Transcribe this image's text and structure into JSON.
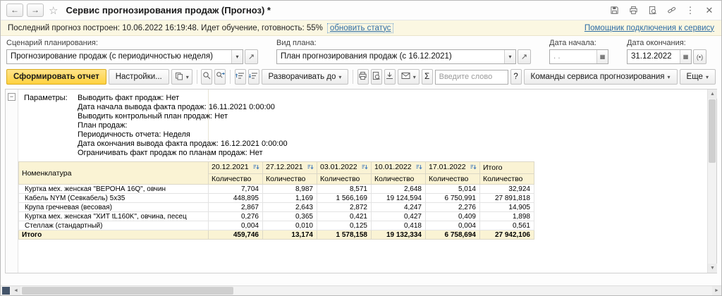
{
  "icons": {
    "back": "←",
    "forward": "→",
    "star": "☆",
    "more": "⋮",
    "close": "✕",
    "dropdown": "▾",
    "open": "↗",
    "calendar": "▦",
    "period": "(•)",
    "minus": "−",
    "scroll_up": "▲",
    "scroll_down": "▼",
    "scroll_left": "◄",
    "scroll_right": "►"
  },
  "window": {
    "title": "Сервис прогнозирования продаж (Прогноз) *"
  },
  "status": {
    "text": "Последний прогноз построен: 10.06.2022 16:19:48. Идет обучение, готовность: 55%",
    "refresh_link": "обновить статус",
    "helper_link": "Помощник подключения к сервису"
  },
  "form": {
    "scenario": {
      "label": "Сценарий планирования:",
      "value": "Прогнозирование продаж (с периодичностью неделя)"
    },
    "plan_kind": {
      "label": "Вид плана:",
      "value": "План прогнозирования продаж (с 16.12.2021)"
    },
    "date_start": {
      "label": "Дата начала:",
      "empty_mask": ". ."
    },
    "date_end": {
      "label": "Дата окончания:",
      "value": "31.12.2022"
    }
  },
  "toolbar": {
    "generate_label": "Сформировать отчет",
    "settings_label": "Настройки...",
    "expand_label": "Разворачивать до",
    "sigma_label": "Σ",
    "search_placeholder": "Введите слово",
    "help_label": "?",
    "commands_label": "Команды сервиса прогнозирования",
    "more_label": "Еще"
  },
  "report": {
    "params_label": "Параметры:",
    "params": [
      "Выводить факт продаж: Нет",
      "Дата начала вывода факта продаж: 16.11.2021 0:00:00",
      "Выводить контрольный план продаж: Нет",
      "План продаж:",
      "Периодичность отчета: Неделя",
      "Дата окончания вывода факта продаж: 16.12.2021 0:00:00",
      "Ограничивать факт продаж по планам продаж: Нет"
    ],
    "table": {
      "name_header": "Номенклатура",
      "qty_header": "Количество",
      "total_header": "Итого",
      "date_columns": [
        "20.12.2021",
        "27.12.2021",
        "03.01.2022",
        "10.01.2022",
        "17.01.2022"
      ],
      "rows": [
        {
          "name": "Куртка мех. женская \"ВЕРОНА 16Q\", овчин",
          "values": [
            "7,704",
            "8,987",
            "8,571",
            "2,648",
            "5,014",
            "32,924"
          ]
        },
        {
          "name": "Кабель NYM (Севкабель) 5х35",
          "values": [
            "448,895",
            "1,169",
            "1 566,169",
            "19 124,594",
            "6 750,991",
            "27 891,818"
          ]
        },
        {
          "name": "Крупа гречневая (весовая)",
          "values": [
            "2,867",
            "2,643",
            "2,872",
            "4,247",
            "2,276",
            "14,905"
          ]
        },
        {
          "name": "Куртка мех. женская \"ХИТ tL160K\", овчина, песец",
          "values": [
            "0,276",
            "0,365",
            "0,421",
            "0,427",
            "0,409",
            "1,898"
          ]
        },
        {
          "name": "Стеллаж (стандартный)",
          "values": [
            "0,004",
            "0,010",
            "0,125",
            "0,418",
            "0,004",
            "0,561"
          ]
        }
      ],
      "total_row": {
        "name": "Итого",
        "values": [
          "459,746",
          "13,174",
          "1 578,158",
          "19 132,334",
          "6 758,694",
          "27 942,106"
        ]
      }
    }
  }
}
